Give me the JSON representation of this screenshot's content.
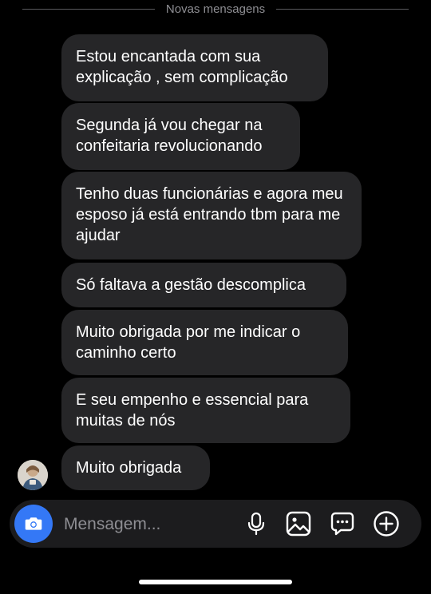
{
  "divider": {
    "label": "Novas mensagens"
  },
  "messages": [
    {
      "text": "Estou encantada com sua explicação , sem complicação"
    },
    {
      "text": "Segunda já vou chegar na confeitaria revolucionando"
    },
    {
      "text": "Tenho duas funcionárias e agora meu esposo já está entrando tbm para me ajudar"
    },
    {
      "text": "Só faltava a gestão descomplica"
    },
    {
      "text": "Muito obrigada por me indicar o caminho certo"
    },
    {
      "text": "E seu empenho e essencial para muitas de nós"
    },
    {
      "text": "Muito obrigada"
    }
  ],
  "composer": {
    "placeholder": "Mensagem...",
    "icons": [
      "camera-icon",
      "microphone-icon",
      "image-icon",
      "sticker-chat-icon",
      "plus-circle-icon"
    ]
  },
  "colors": {
    "bubble": "#262628",
    "accent": "#3478f6",
    "background": "#000000"
  }
}
